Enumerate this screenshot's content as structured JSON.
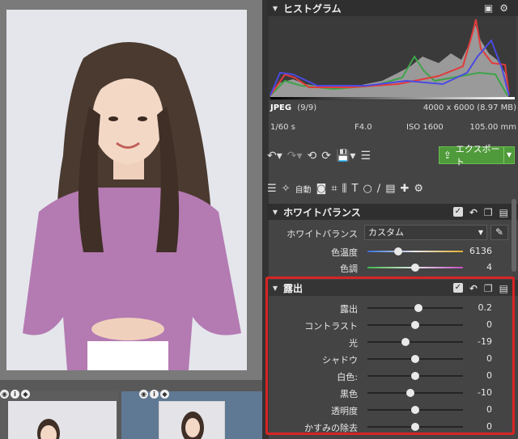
{
  "histogram": {
    "title": "ヒストグラム"
  },
  "file_info": {
    "format": "JPEG",
    "count": "(9/9)",
    "dimensions": "4000 x 6000 (8.97 MB)",
    "shutter": "1/60 s",
    "aperture": "F4.0",
    "iso": "ISO 1600",
    "focal": "105.00 mm"
  },
  "toolbar": {
    "export_label": "エクスポート",
    "auto_label": "自動"
  },
  "white_balance": {
    "title": "ホワイトバランス",
    "wb_label": "ホワイトバランス",
    "wb_value": "カスタム",
    "sliders": [
      {
        "label": "色温度",
        "value": "6136",
        "position": 0.32
      },
      {
        "label": "色調",
        "value": "4",
        "position": 0.5
      }
    ]
  },
  "exposure": {
    "title": "露出",
    "sliders": [
      {
        "label": "露出",
        "value": "0.2",
        "position": 0.53
      },
      {
        "label": "コントラスト",
        "value": "0",
        "position": 0.5
      },
      {
        "label": "光",
        "value": "-19",
        "position": 0.4
      },
      {
        "label": "シャドウ",
        "value": "0",
        "position": 0.5
      },
      {
        "label": "白色:",
        "value": "0",
        "position": 0.5
      },
      {
        "label": "黒色",
        "value": "-10",
        "position": 0.45
      },
      {
        "label": "透明度",
        "value": "0",
        "position": 0.5
      },
      {
        "label": "かすみの除去",
        "value": "0",
        "position": 0.5
      }
    ]
  },
  "colors": {
    "accent_green": "#4f9a3a",
    "highlight_red": "#d82424"
  }
}
